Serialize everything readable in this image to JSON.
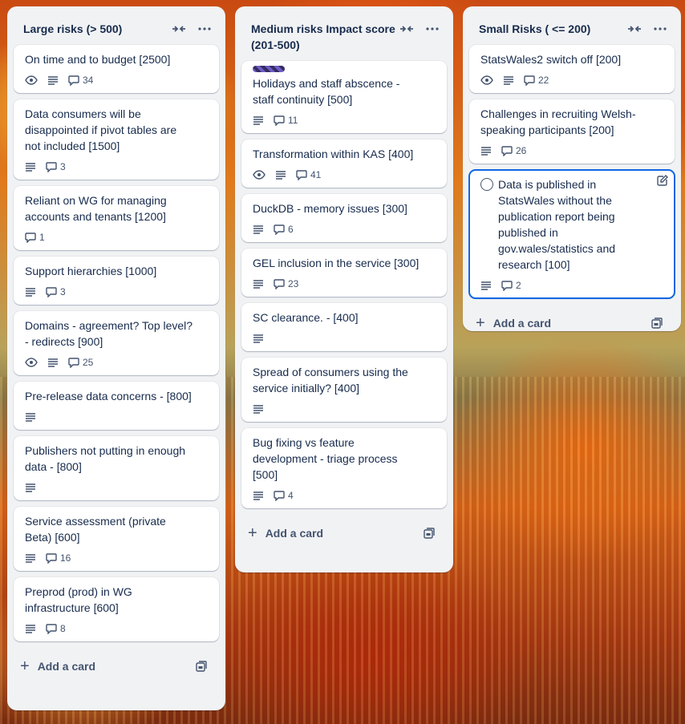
{
  "lists": [
    {
      "title": "Large risks (> 500)",
      "add_card_label": "Add a card",
      "cards": [
        {
          "title": "On time and to budget [2500]",
          "comments": "34"
        },
        {
          "title": "Data consumers will be disappointed if pivot tables are not included [1500]",
          "comments": "3"
        },
        {
          "title": "Reliant on WG for managing accounts and tenants [1200]",
          "comments": "1"
        },
        {
          "title": "Support hierarchies [1000]",
          "comments": "3"
        },
        {
          "title": "Domains - agreement? Top level? - redirects [900]",
          "comments": "25"
        },
        {
          "title": "Pre-release data concerns - [800]"
        },
        {
          "title": "Publishers not putting in enough data - [800]"
        },
        {
          "title": "Service assessment (private Beta) [600]",
          "comments": "16"
        },
        {
          "title": "Preprod (prod) in WG infrastructure [600]",
          "comments": "8"
        }
      ]
    },
    {
      "title": "Medium risks Impact score (201-500)",
      "add_card_label": "Add a card",
      "cards": [
        {
          "title": "Holidays and staff abscence - staff continuity [500]",
          "comments": "11"
        },
        {
          "title": "Transformation within KAS [400]",
          "comments": "41"
        },
        {
          "title": "DuckDB - memory issues [300]",
          "comments": "6"
        },
        {
          "title": "GEL inclusion in the service [300]",
          "comments": "23"
        },
        {
          "title": "SC clearance. - [400]"
        },
        {
          "title": "Spread of consumers using the service initially? [400]"
        },
        {
          "title": "Bug fixing vs feature development - triage process [500]",
          "comments": "4"
        }
      ]
    },
    {
      "title": "Small Risks ( <= 200)",
      "add_card_label": "Add a card",
      "cards": [
        {
          "title": "StatsWales2 switch off [200]",
          "comments": "22"
        },
        {
          "title": "Challenges in recruiting Welsh-speaking participants [200]",
          "comments": "26"
        },
        {
          "title": "Data is published in StatsWales without the publication report being published in gov.wales/statistics and research [100]",
          "comments": "2"
        }
      ]
    }
  ]
}
